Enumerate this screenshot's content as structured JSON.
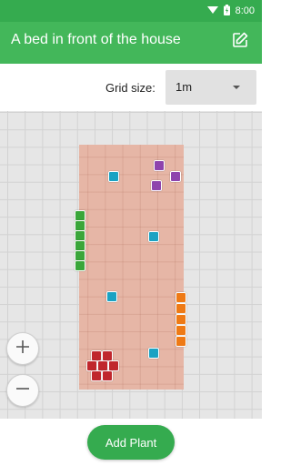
{
  "status_bar": {
    "time": "8:00",
    "icons": [
      "wifi-icon",
      "battery-icon"
    ]
  },
  "app_bar": {
    "title": "A bed in front of the house",
    "edit_icon": "edit-icon"
  },
  "grid": {
    "label": "Grid size:",
    "selected": "1m"
  },
  "colors": {
    "primary": "#43b75a",
    "status_bar": "#35ab4f",
    "bed": "#e6b6a6",
    "plant_teal": "#1aa2c3",
    "plant_purple": "#8e44ad",
    "plant_green": "#3aa63a",
    "plant_orange": "#ee7a16",
    "plant_red": "#c0272d"
  },
  "zoom": {
    "in_icon": "plus-icon",
    "out_icon": "minus-icon"
  },
  "actions": {
    "add_plant": "Add Plant"
  }
}
